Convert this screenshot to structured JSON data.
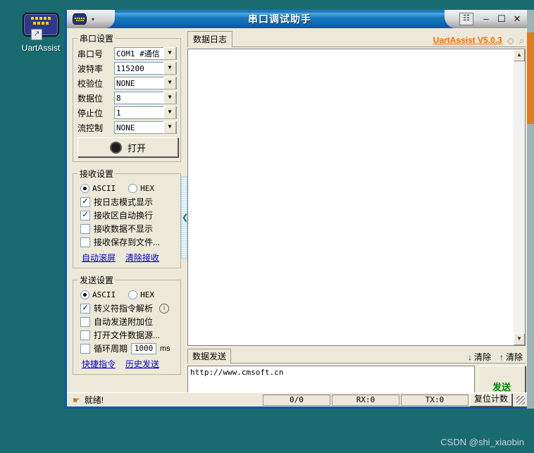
{
  "desktop": {
    "icon_name": "serial-port-icon",
    "shortcut_label": "UartAssist",
    "shortcut_arrow": "↗",
    "background_color": "#1a6b70"
  },
  "window": {
    "title": "串口调试助手",
    "sysmenu_caret": "▾",
    "pin_icon": "☷",
    "minimize": "–",
    "maximize": "☐",
    "close": "✕",
    "accent_color": "#0a57b2"
  },
  "brand": {
    "text": "UartAssist V5.0.3",
    "color": "#ff6600",
    "diamond_icon": "◇",
    "bell_icon": "⌕"
  },
  "serial_settings": {
    "legend": "串口设置",
    "fields": [
      {
        "label": "串口号",
        "value": "COM1 #通信"
      },
      {
        "label": "波特率",
        "value": "115200"
      },
      {
        "label": "校验位",
        "value": "NONE"
      },
      {
        "label": "数据位",
        "value": "8"
      },
      {
        "label": "停止位",
        "value": "1"
      },
      {
        "label": "流控制",
        "value": "NONE"
      }
    ],
    "open_button": "打开",
    "dropdown_arrow": "▼"
  },
  "receive_settings": {
    "legend": "接收设置",
    "mode_ascii": "ASCII",
    "mode_hex": "HEX",
    "mode_selected": "ASCII",
    "checkboxes": [
      {
        "label": "按日志模式显示",
        "checked": true
      },
      {
        "label": "接收区自动换行",
        "checked": true
      },
      {
        "label": "接收数据不显示",
        "checked": false
      },
      {
        "label": "接收保存到文件...",
        "checked": false
      }
    ],
    "links": [
      "自动滚屏",
      "清除接收"
    ]
  },
  "send_settings": {
    "legend": "发送设置",
    "mode_ascii": "ASCII",
    "mode_hex": "HEX",
    "mode_selected": "ASCII",
    "checkboxes": [
      {
        "label": "转义符指令解析",
        "checked": true,
        "info": true
      },
      {
        "label": "自动发送附加位",
        "checked": false
      },
      {
        "label": "打开文件数据源...",
        "checked": false
      }
    ],
    "cycle_label": "循环周期",
    "cycle_value": "1000",
    "cycle_unit": "ms",
    "cycle_checked": false,
    "links": [
      "快捷指令",
      "历史发送"
    ]
  },
  "log_panel": {
    "tab_label": "数据日志",
    "content": "",
    "scroll_up": "▲",
    "scroll_down": "▼"
  },
  "send_panel": {
    "tab_label": "数据发送",
    "clear_receive": {
      "label": "清除",
      "icon": "↓"
    },
    "clear_send": {
      "label": "清除",
      "icon": "↑"
    },
    "text_value": "http://www.cmsoft.cn",
    "send_button": "发送",
    "send_button_color": "#008000"
  },
  "status_bar": {
    "icon": "☛",
    "ready_text": "就绪!",
    "progress": "0/0",
    "rx": "RX:0",
    "tx": "TX:0",
    "reset_button": "复位计数"
  },
  "splitter": {
    "collapse_arrow": "❮"
  },
  "outer_scrollbar": {
    "thumb_color": "#e07b20"
  },
  "watermark": {
    "text": "CSDN @shi_xiaobin"
  }
}
